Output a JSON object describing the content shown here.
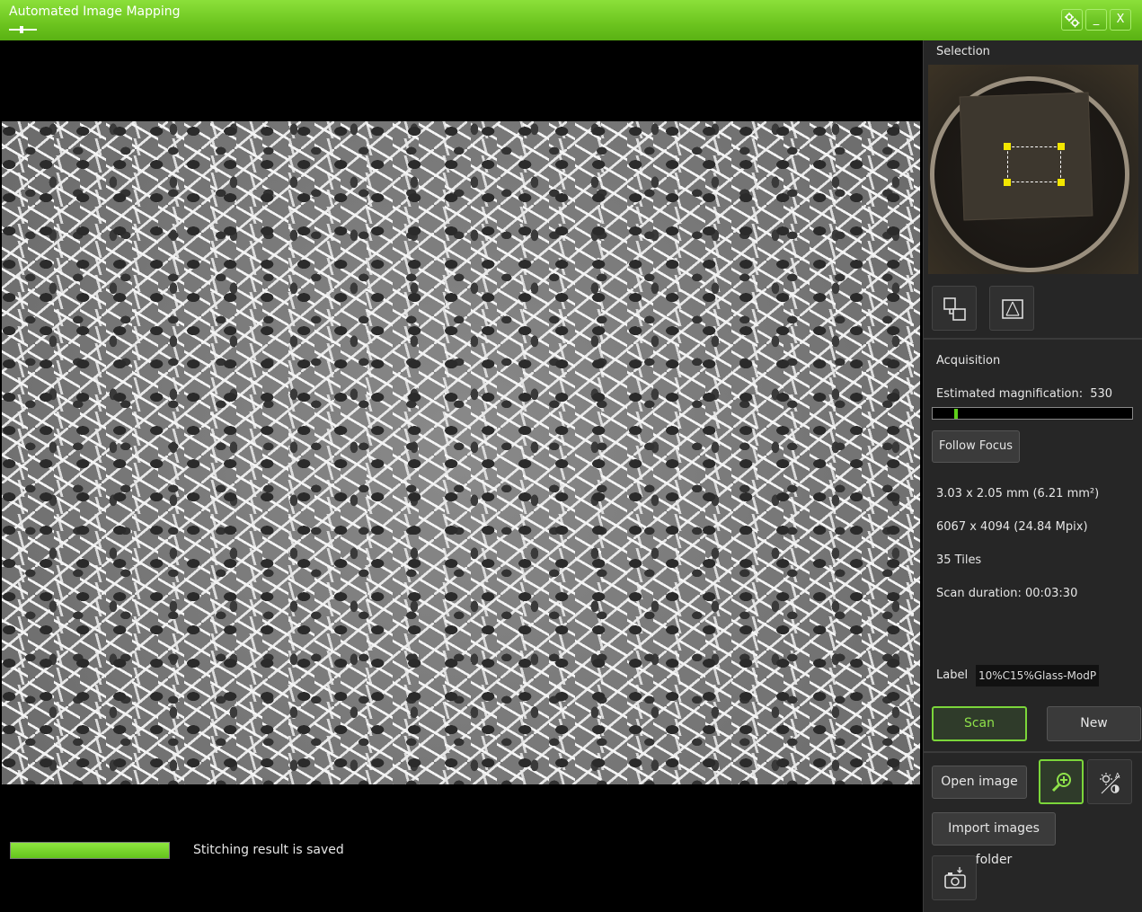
{
  "window": {
    "title": "Automated Image Mapping",
    "buttons": {
      "settings_icon": "gear-icon",
      "minimize": "_",
      "close": "X"
    }
  },
  "status": {
    "progress": 1.0,
    "text": "Stitching result is saved"
  },
  "panel": {
    "selection_label": "Selection",
    "acquisition_label": "Acquisition",
    "magnification_label": "Estimated magnification:",
    "magnification_value": "530",
    "magnification_level": 0.11,
    "follow_focus": "Follow Focus",
    "area": "3.03 x 2.05 mm (6.21 mm²)",
    "pixels": "6067 x 4094 (24.84 Mpix)",
    "tiles": "35 Tiles",
    "scan_duration": "Scan duration: 00:03:30",
    "label_caption": "Label",
    "label_value": "10%C15%Glass-ModP",
    "scan": "Scan",
    "new": "New",
    "open_image": "Open image",
    "import_folder": "Import images folder"
  },
  "colors": {
    "accent": "#6cc41f",
    "panel_bg": "#262626",
    "handle": "#f2e600"
  }
}
